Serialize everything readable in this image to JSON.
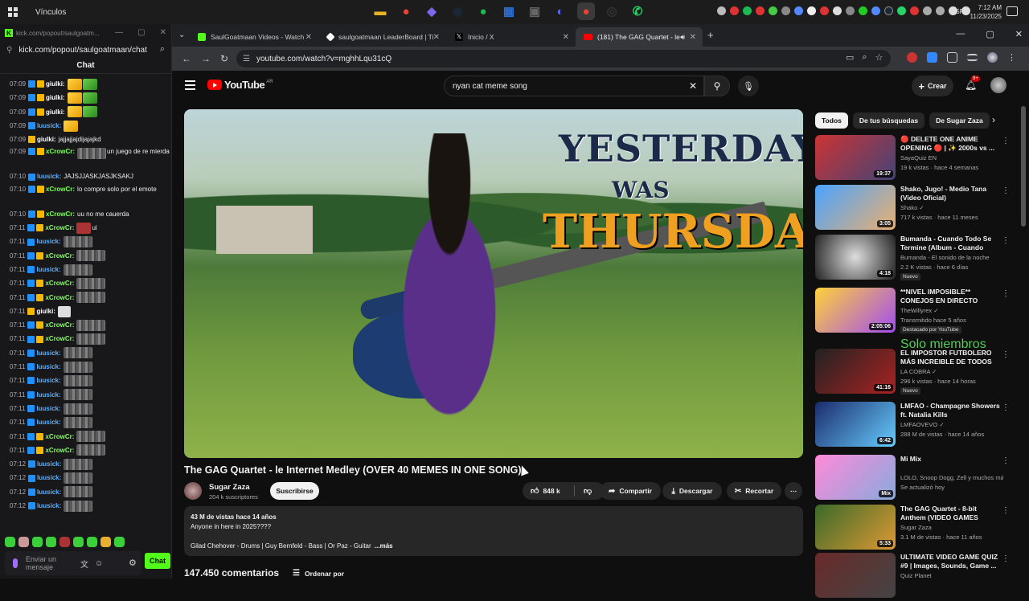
{
  "taskbar": {
    "vinculos": "Vínculos",
    "lang": "ESP",
    "time": "7:12 AM",
    "date": "11/23/2025",
    "apps": [
      {
        "icon": "file-explorer-icon",
        "color": "#e6b422",
        "glyph": "▬"
      },
      {
        "icon": "chrome-icon",
        "color": "#ea4335",
        "glyph": "●"
      },
      {
        "icon": "copilot-icon",
        "color": "#7b68ee",
        "glyph": "◆"
      },
      {
        "icon": "steam-icon",
        "color": "#1b2838",
        "glyph": "◉"
      },
      {
        "icon": "spotify-icon",
        "color": "#1db954",
        "glyph": "●"
      },
      {
        "icon": "store-icon",
        "color": "#2a6fd6",
        "glyph": "▦"
      },
      {
        "icon": "app-icon",
        "color": "#666666",
        "glyph": "▣"
      },
      {
        "icon": "discord-icon",
        "color": "#5865f2",
        "glyph": "◐"
      },
      {
        "icon": "chrome-active-icon",
        "color": "#ea4335",
        "glyph": "●"
      },
      {
        "icon": "obs-icon",
        "color": "#333333",
        "glyph": "◎"
      },
      {
        "icon": "whatsapp-icon",
        "color": "#25d366",
        "glyph": "✆"
      }
    ]
  },
  "kick": {
    "title_url": "kick.com/popout/saulgoatm...",
    "url": "kick.com/popout/saulgoatmaan/chat",
    "chat_header": "Chat",
    "input_placeholder": "Enviar un mensaje",
    "send_label": "Chat",
    "messages": [
      {
        "time": "07:09",
        "badges": [
          "blue",
          "gold"
        ],
        "user": "giulki:",
        "cls": "giulki",
        "msg": "",
        "emotes": [
          "y",
          "g"
        ]
      },
      {
        "time": "07:09",
        "badges": [
          "blue",
          "gold"
        ],
        "user": "giulki:",
        "cls": "giulki",
        "msg": "",
        "emotes": [
          "y",
          "g"
        ]
      },
      {
        "time": "07:09",
        "badges": [
          "blue",
          "gold"
        ],
        "user": "giulki:",
        "cls": "giulki",
        "msg": "",
        "emotes": [
          "y",
          "g"
        ]
      },
      {
        "time": "07:09",
        "badges": [
          "blue"
        ],
        "user": "luusick:",
        "cls": "luusick",
        "msg": "",
        "emotes": [
          "y"
        ]
      },
      {
        "time": "07:09",
        "badges": [
          "gold"
        ],
        "user": "giulki:",
        "cls": "giulki",
        "msg": "jajjajjajdijajajkd",
        "emotes": []
      },
      {
        "time": "07:09",
        "badges": [
          "blue",
          "gold"
        ],
        "user": "xCrowCr:",
        "cls": "xcrow",
        "msg": "un juego de re mierda",
        "emotes": [
          "blur"
        ],
        "tall": true
      },
      {
        "time": "07:10",
        "badges": [
          "blue"
        ],
        "user": "luusick:",
        "cls": "luusick",
        "msg": "JAJSJJASKJASJKSAKJ",
        "emotes": []
      },
      {
        "time": "07:10",
        "badges": [
          "blue",
          "gold"
        ],
        "user": "xCrowCr:",
        "cls": "xcrow",
        "msg": "lo compre solo por el emote",
        "emotes": [],
        "tall": true
      },
      {
        "time": "07:10",
        "badges": [
          "blue",
          "gold"
        ],
        "user": "xCrowCr:",
        "cls": "xcrow",
        "msg": "uu no me cauerda",
        "emotes": []
      },
      {
        "time": "07:11",
        "badges": [
          "blue",
          "gold"
        ],
        "user": "xCrowCr:",
        "cls": "xcrow",
        "msg": "ui",
        "emotes": [
          "red"
        ]
      },
      {
        "time": "07:11",
        "badges": [
          "blue"
        ],
        "user": "luusick:",
        "cls": "luusick",
        "msg": "",
        "emotes": [
          "blur"
        ]
      },
      {
        "time": "07:11",
        "badges": [
          "blue",
          "gold"
        ],
        "user": "xCrowCr:",
        "cls": "xcrow",
        "msg": "",
        "emotes": [
          "blur"
        ]
      },
      {
        "time": "07:11",
        "badges": [
          "blue"
        ],
        "user": "luusick:",
        "cls": "luusick",
        "msg": "",
        "emotes": [
          "blur"
        ]
      },
      {
        "time": "07:11",
        "badges": [
          "blue",
          "gold"
        ],
        "user": "xCrowCr:",
        "cls": "xcrow",
        "msg": "",
        "emotes": [
          "blur"
        ]
      },
      {
        "time": "07:11",
        "badges": [
          "blue",
          "gold"
        ],
        "user": "xCrowCr:",
        "cls": "xcrow",
        "msg": "",
        "emotes": [
          "blur"
        ]
      },
      {
        "time": "07:11",
        "badges": [
          "gold"
        ],
        "user": "giulki:",
        "cls": "giulki",
        "msg": "",
        "emotes": [
          "w"
        ]
      },
      {
        "time": "07:11",
        "badges": [
          "blue",
          "gold"
        ],
        "user": "xCrowCr:",
        "cls": "xcrow",
        "msg": "",
        "emotes": [
          "blur"
        ]
      },
      {
        "time": "07:11",
        "badges": [
          "blue",
          "gold"
        ],
        "user": "xCrowCr:",
        "cls": "xcrow",
        "msg": "",
        "emotes": [
          "blur"
        ]
      },
      {
        "time": "07:11",
        "badges": [
          "blue"
        ],
        "user": "luusick:",
        "cls": "luusick",
        "msg": "",
        "emotes": [
          "blur"
        ]
      },
      {
        "time": "07:11",
        "badges": [
          "blue"
        ],
        "user": "luusick:",
        "cls": "luusick",
        "msg": "",
        "emotes": [
          "blur"
        ]
      },
      {
        "time": "07:11",
        "badges": [
          "blue"
        ],
        "user": "luusick:",
        "cls": "luusick",
        "msg": "",
        "emotes": [
          "blur"
        ]
      },
      {
        "time": "07:11",
        "badges": [
          "blue"
        ],
        "user": "luusick:",
        "cls": "luusick",
        "msg": "",
        "emotes": [
          "blur"
        ]
      },
      {
        "time": "07:11",
        "badges": [
          "blue"
        ],
        "user": "luusick:",
        "cls": "luusick",
        "msg": "",
        "emotes": [
          "blur"
        ]
      },
      {
        "time": "07:11",
        "badges": [
          "blue"
        ],
        "user": "luusick:",
        "cls": "luusick",
        "msg": "",
        "emotes": [
          "blur"
        ]
      },
      {
        "time": "07:11",
        "badges": [
          "blue",
          "gold"
        ],
        "user": "xCrowCr:",
        "cls": "xcrow",
        "msg": "",
        "emotes": [
          "blur"
        ]
      },
      {
        "time": "07:11",
        "badges": [
          "blue",
          "gold"
        ],
        "user": "xCrowCr:",
        "cls": "xcrow",
        "msg": "",
        "emotes": [
          "blur"
        ]
      },
      {
        "time": "07:12",
        "badges": [
          "blue"
        ],
        "user": "luusick:",
        "cls": "luusick",
        "msg": "",
        "emotes": [
          "blur"
        ]
      },
      {
        "time": "07:12",
        "badges": [
          "blue"
        ],
        "user": "luusick:",
        "cls": "luusick",
        "msg": "",
        "emotes": [
          "blur"
        ]
      },
      {
        "time": "07:12",
        "badges": [
          "blue"
        ],
        "user": "luusick:",
        "cls": "luusick",
        "msg": "",
        "emotes": [
          "blur"
        ]
      },
      {
        "time": "07:12",
        "badges": [
          "blue"
        ],
        "user": "luusick:",
        "cls": "luusick",
        "msg": "",
        "emotes": [
          "blur"
        ]
      }
    ]
  },
  "chrome": {
    "tabs": [
      {
        "label": "SaulGoatmaan Videos - Watch",
        "fav": "#53fc18",
        "icon": "kick-icon"
      },
      {
        "label": "saulgoatmaan LeaderBoard | Ti",
        "fav": "#ffffff",
        "icon": "diamond-icon"
      },
      {
        "label": "Inicio / X",
        "fav": "#222222",
        "icon": "x-icon"
      },
      {
        "label": "(181) The GAG Quartet - le",
        "fav": "#ff0000",
        "icon": "youtube-icon"
      }
    ],
    "url": "youtube.com/watch?v=mghhLqu31cQ"
  },
  "youtube": {
    "logo_text": "YouTube",
    "region": "AR",
    "search_value": "nyan cat meme song",
    "create_label": "Crear",
    "notif_count": "9+",
    "overlay": {
      "line1": "YESTERDAY",
      "line2": "WAS",
      "line3": "THURSDAY"
    },
    "video_title": "The GAG Quartet - le Internet Medley (OVER 40 MEMES IN ONE SONG)",
    "channel": "Sugar Zaza",
    "subs": "204 k suscriptores",
    "subscribe": "Suscribirse",
    "likes": "848 k",
    "share": "Compartir",
    "download": "Descargar",
    "clip": "Recortar",
    "views_line": "43 M de vistas  hace 14 años",
    "desc_line2": "Anyone in here in 2025????",
    "desc_line3": "Gilad Chehover - Drums | Guy Bernfeld - Bass | Or Paz - Guitar",
    "more": "...más",
    "comments": "147.450 comentarios",
    "order": "Ordenar por",
    "chips": [
      "Todos",
      "De tus búsquedas",
      "De Sugar Zaza"
    ],
    "recs": [
      {
        "title": "🔴 DELETE ONE ANIME OPENING 🔴 | ✨ 2000s vs ...",
        "channel": "SayaQuiz EN",
        "meta": "19 k vistas · hace 4 semanas",
        "dur": "19:37",
        "badge": "",
        "thumb": "linear-gradient(135deg,#c33,#447)"
      },
      {
        "title": "Shako, Jugo! - Medio Tana (Video Oficial)",
        "channel": "Shako ✓",
        "meta": "717 k vistas · hace 11 meses",
        "dur": "3:05",
        "badge": "",
        "thumb": "linear-gradient(135deg,#4aa3ff,#e9b070)"
      },
      {
        "title": "Bumanda - Cuando Todo Se Termine (Album - Cuando Tod...",
        "channel": "Bumanda - El sonido de la noche",
        "meta": "2.2 K vistas · hace 6 días",
        "dur": "4:18",
        "badge": "Nuevo",
        "thumb": "radial-gradient(circle,#ddd,#222)"
      },
      {
        "title": "**NIVEL IMPOSIBLE** CONEJOS EN DIRECTO",
        "channel": "TheWillyrex ✓",
        "meta": "Transmitido hace 5 años",
        "dur": "2:05:06",
        "badge": "Destacado por YouTube",
        "thumb": "linear-gradient(135deg,#ffd23a,#a24cf0)"
      },
      {
        "title": "EL IMPOSTOR FUTBOLERO MÁS INCREIBLE DE TODOS LO...",
        "channel": "LA COBRA ✓",
        "meta": "296 k vistas · hace 14 horas",
        "dur": "41:16",
        "badge": "Nuevo",
        "thumb": "linear-gradient(135deg,#222,#a22)"
      },
      {
        "title": "LMFAO - Champagne Showers ft. Natalia Kills",
        "channel": "LMFAOVEVO ✓",
        "meta": "288 M de vistas · hace 14 años",
        "dur": "6:42",
        "badge": "",
        "thumb": "linear-gradient(135deg,#1b2b6b,#6cf)"
      },
      {
        "title": "Mi Mix",
        "channel": "LOLO, Snoop Dogg, Zell y muchos más",
        "meta": "Se actualizó hoy",
        "dur": "Mix",
        "badge": "",
        "thumb": "linear-gradient(135deg,#ff8ad8,#8ad)"
      },
      {
        "title": "The GAG Quartet - 8-bit Anthem (VIDEO GAMES MEDLEY)",
        "channel": "Sugar Zaza",
        "meta": "3.1 M de vistas · hace 11 años",
        "dur": "5:33",
        "badge": "",
        "thumb": "linear-gradient(135deg,#3a6a2a,#d93)"
      },
      {
        "title": "ULTIMATE VIDEO GAME QUIZ #9 | Images, Sounds, Game ...",
        "channel": "Quiz Planet",
        "meta": "",
        "dur": "",
        "badge": "",
        "thumb": "linear-gradient(135deg,#6a2a2a,#444)"
      }
    ],
    "members_badge": "Solo miembros"
  }
}
